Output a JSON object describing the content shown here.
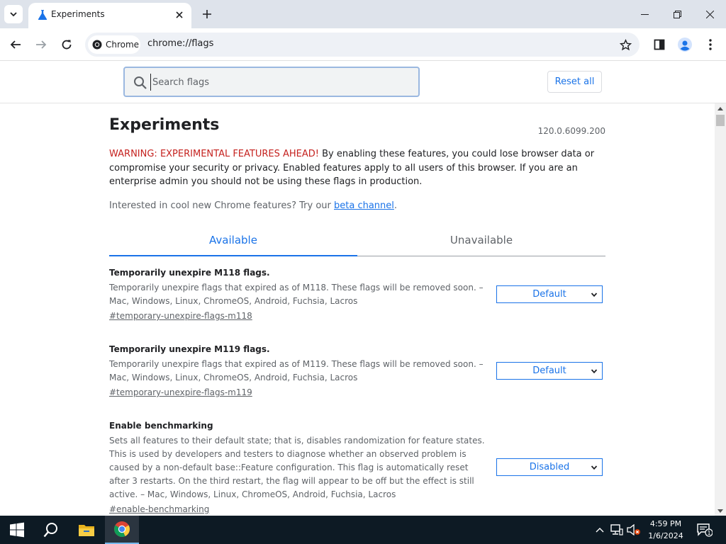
{
  "window": {
    "tab_title": "Experiments",
    "controls": [
      "minimize",
      "restore",
      "close"
    ]
  },
  "toolbar": {
    "chip_label": "Chrome",
    "url": "chrome://flags"
  },
  "flags_header": {
    "search_placeholder": "Search flags",
    "reset_label": "Reset all"
  },
  "page": {
    "title": "Experiments",
    "version": "120.0.6099.200",
    "warning_strong": "WARNING: EXPERIMENTAL FEATURES AHEAD!",
    "warning_text": " By enabling these features, you could lose browser data or compromise your security or privacy. Enabled features apply to all users of this browser. If you are an enterprise admin you should not be using these flags in production.",
    "beta_prefix": "Interested in cool new Chrome features? Try our ",
    "beta_link": "beta channel",
    "beta_suffix": ".",
    "tabs": [
      {
        "label": "Available",
        "active": true
      },
      {
        "label": "Unavailable",
        "active": false
      }
    ]
  },
  "experiments": [
    {
      "name": "Temporarily unexpire M118 flags.",
      "description": "Temporarily unexpire flags that expired as of M118. These flags will be removed soon. – Mac, Windows, Linux, ChromeOS, Android, Fuchsia, Lacros",
      "link": "#temporary-unexpire-flags-m118",
      "value": "Default"
    },
    {
      "name": "Temporarily unexpire M119 flags.",
      "description": "Temporarily unexpire flags that expired as of M119. These flags will be removed soon. – Mac, Windows, Linux, ChromeOS, Android, Fuchsia, Lacros",
      "link": "#temporary-unexpire-flags-m119",
      "value": "Default"
    },
    {
      "name": "Enable benchmarking",
      "description": "Sets all features to their default state; that is, disables randomization for feature states. This is used by developers and testers to diagnose whether an observed problem is caused by a non-default base::Feature configuration. This flag is automatically reset after 3 restarts. On the third restart, the flag will appear to be off but the effect is still active. – Mac, Windows, Linux, ChromeOS, Android, Fuchsia, Lacros",
      "link": "#enable-benchmarking",
      "value": "Disabled"
    }
  ],
  "taskbar": {
    "time": "4:59 PM",
    "date": "1/6/2024",
    "notification_count": "1"
  },
  "colors": {
    "accent": "#1a73e8",
    "warning": "#c5221f",
    "taskbar": "#0d1a24"
  }
}
